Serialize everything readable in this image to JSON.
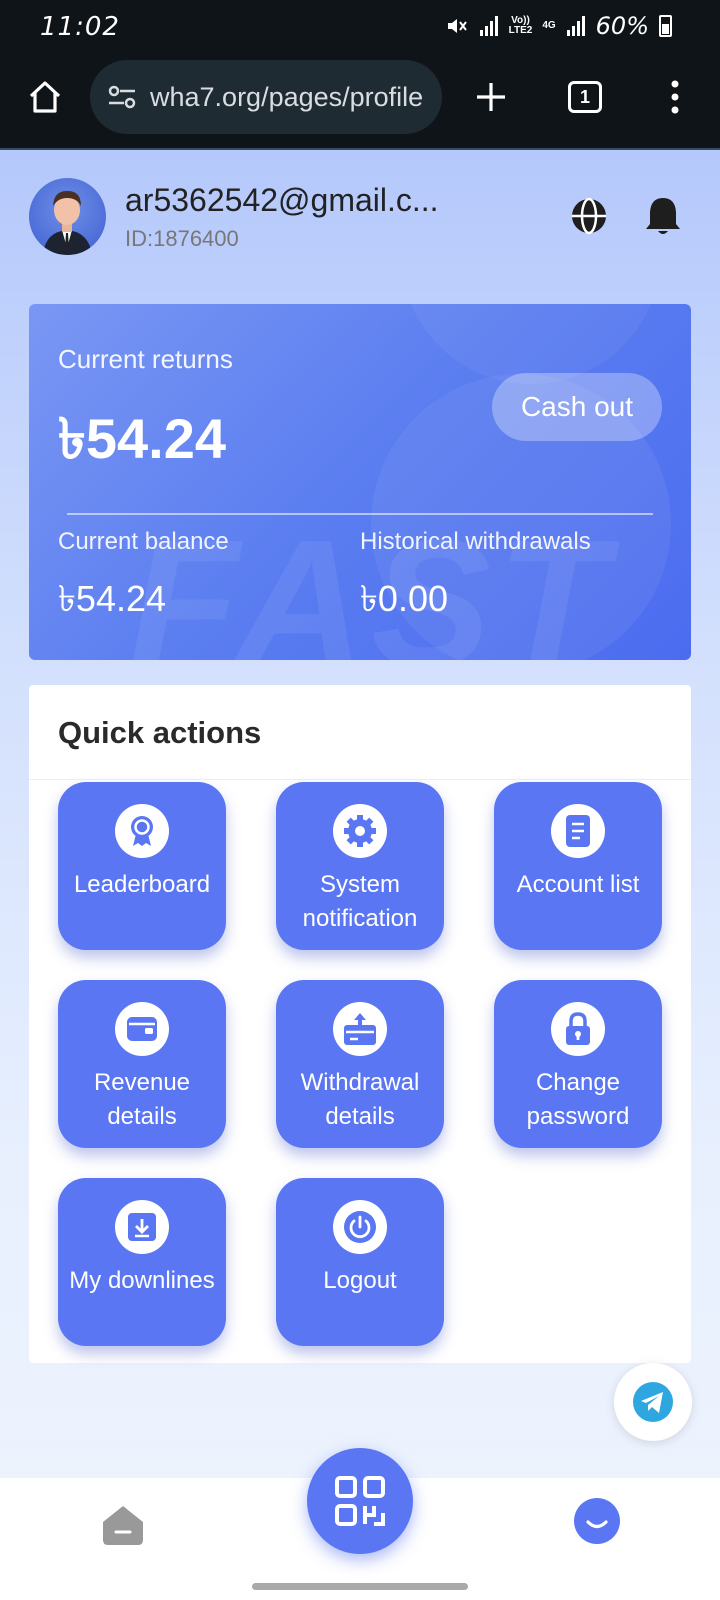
{
  "status_bar": {
    "time": "11:02",
    "network_top": "Vo))",
    "network_bottom": "LTE2",
    "network_type": "4G",
    "battery": "60%"
  },
  "browser": {
    "url": "wha7.org/pages/profile",
    "tab_count": "1"
  },
  "profile": {
    "email": "ar5362542@gmail.c...",
    "id": "ID:1876400"
  },
  "card": {
    "returns_label": "Current returns",
    "returns_value": "৳54.24",
    "cashout_label": "Cash out",
    "balance_label": "Current balance",
    "balance_value": "৳54.24",
    "withdrawals_label": "Historical withdrawals",
    "withdrawals_value": "৳0.00",
    "watermark": "FAST"
  },
  "quick_actions": {
    "title": "Quick actions",
    "items": [
      {
        "label": "Leaderboard",
        "icon": "award-icon"
      },
      {
        "label": "System notification",
        "icon": "gear-icon"
      },
      {
        "label": "Account list",
        "icon": "document-icon"
      },
      {
        "label": "Revenue details",
        "icon": "wallet-icon"
      },
      {
        "label": "Withdrawal details",
        "icon": "cash-box-icon"
      },
      {
        "label": "Change password",
        "icon": "lock-icon"
      },
      {
        "label": "My downlines",
        "icon": "download-icon"
      },
      {
        "label": "Logout",
        "icon": "power-icon"
      }
    ]
  },
  "colors": {
    "accent": "#5a76f2",
    "card_start": "#7a97f4",
    "card_end": "#4c6cf0"
  }
}
